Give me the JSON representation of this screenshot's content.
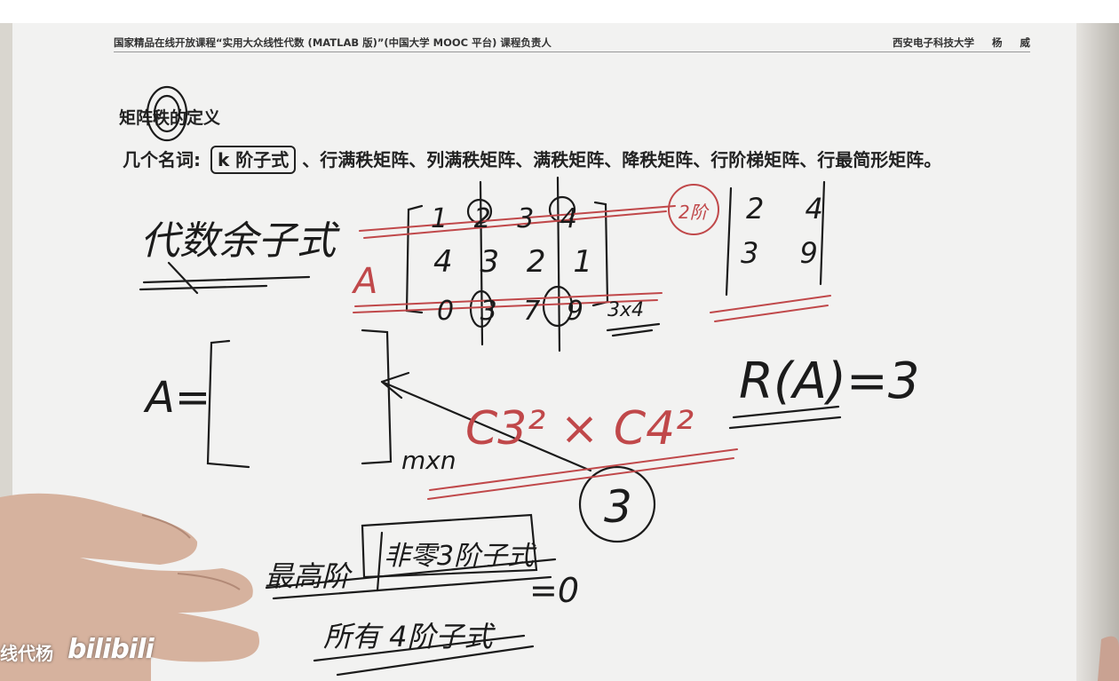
{
  "header": {
    "left": "国家精品在线开放课程“实用大众线性代数 (MATLAB 版)”(中国大学 MOOC 平台) 课程负责人",
    "right": "西安电子科技大学 杨 威"
  },
  "slide": {
    "title": "矩阵秩的定义",
    "terms_label": "几个名词:",
    "terms_boxed": "k 阶子式",
    "terms_rest": "、行满秩矩阵、列满秩矩阵、满秩矩阵、降秩矩阵、行阶梯矩阵、行最简形矩阵。"
  },
  "handwriting": {
    "daishu_yuzishi": "代数余子式",
    "matrix_A_label": "A",
    "matrix_rows": [
      "1 2 3 4",
      "4 3 2 1",
      "0 3 7 9"
    ],
    "size_3x4": "3x4",
    "two_rows": "2阶",
    "minor_rows": [
      "2 4",
      "3 9"
    ],
    "rank": "R(A)=3",
    "general_A": "A=",
    "mxn": "mxn",
    "combination": "C3² × C4²",
    "circled_3": "3",
    "highest_order": "最高阶",
    "nonzero_minor": "非零3阶子式",
    "all_4th": "所有 4阶子式",
    "eq_zero": "=0"
  },
  "watermark": {
    "user": "线代杨",
    "logo": "bilibili"
  },
  "colors": {
    "ink_black": "#1b1b1b",
    "ink_red": "#c0484a",
    "paper": "#f2f2f1",
    "skin": "#d8b6a4"
  }
}
